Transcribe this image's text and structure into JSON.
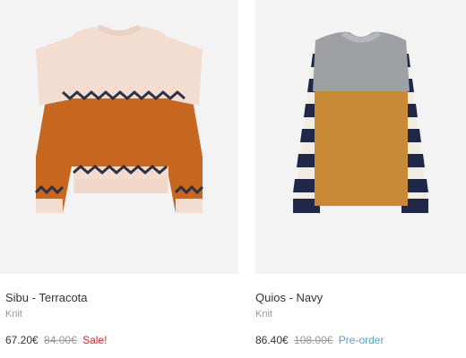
{
  "products": [
    {
      "name": "Sibu - Terracota",
      "category": "Knit",
      "price": "67.20€",
      "old_price": "84.00€",
      "badge": "Sale!",
      "colors": {
        "body": "#f2ddd0",
        "band": "#c7661f",
        "trim": "#2d3142"
      }
    },
    {
      "name": "Quios - Navy",
      "category": "Knit",
      "price": "86.40€",
      "old_price": "108.00€",
      "badge": "Pre-order",
      "colors": {
        "top": "#9ea0a4",
        "body": "#c98a36",
        "stripe_dark": "#1f2848",
        "stripe_light": "#f1ece2"
      }
    }
  ],
  "colors": {
    "sale": "#e02424",
    "preorder": "#5aa0c8",
    "text": "#333333",
    "muted": "#9a9a9a",
    "image_bg": "#f4f3f4"
  }
}
